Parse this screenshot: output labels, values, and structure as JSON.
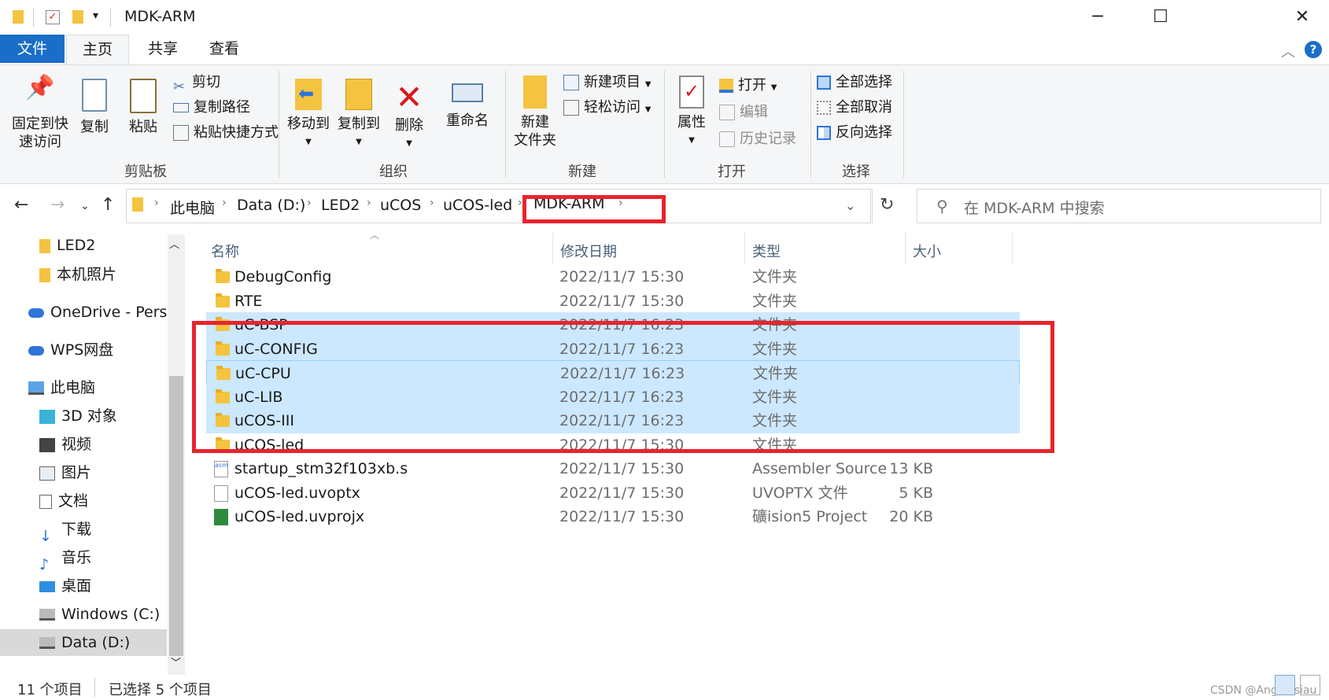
{
  "window": {
    "title": "MDK-ARM",
    "minimize": "─",
    "maximize": "☐",
    "close": "✕",
    "help": "?",
    "collapse": "︿"
  },
  "tabs": [
    "文件",
    "主页",
    "共享",
    "查看"
  ],
  "ribbon": {
    "clipboard": {
      "pin_label1": "固定到快",
      "pin_label2": "速访问",
      "copy": "复制",
      "paste": "粘贴",
      "cut": "剪切",
      "copy_path": "复制路径",
      "paste_shortcut": "粘贴快捷方式",
      "group": "剪贴板"
    },
    "organize": {
      "move_to": "移动到",
      "copy_to": "复制到",
      "delete": "删除",
      "rename": "重命名",
      "group": "组织"
    },
    "new": {
      "new_folder1": "新建",
      "new_folder2": "文件夹",
      "new_item": "新建项目",
      "easy_access": "轻松访问",
      "group": "新建"
    },
    "open": {
      "properties": "属性",
      "open": "打开",
      "edit": "编辑",
      "history": "历史记录",
      "group": "打开"
    },
    "select": {
      "select_all": "全部选择",
      "select_none": "全部取消",
      "invert": "反向选择",
      "group": "选择"
    }
  },
  "address": {
    "crumbs": [
      "此电脑",
      "Data (D:)",
      "LED2",
      "uCOS",
      "uCOS-led",
      "MDK-ARM"
    ],
    "search_placeholder": "在 MDK-ARM 中搜索"
  },
  "nav_pane": [
    {
      "label": "LED2",
      "icon": "folder-icon"
    },
    {
      "label": "本机照片",
      "icon": "folder-icon"
    },
    {
      "label": "OneDrive - Perso",
      "icon": "cloud-icon"
    },
    {
      "label": "WPS网盘",
      "icon": "cloud-icon"
    },
    {
      "label": "此电脑",
      "icon": "computer-icon"
    },
    {
      "label": "3D 对象",
      "icon": "cube-icon"
    },
    {
      "label": "视频",
      "icon": "video-icon"
    },
    {
      "label": "图片",
      "icon": "picture-icon"
    },
    {
      "label": "文档",
      "icon": "document-icon"
    },
    {
      "label": "下载",
      "icon": "download-icon"
    },
    {
      "label": "音乐",
      "icon": "music-icon"
    },
    {
      "label": "桌面",
      "icon": "desktop-icon"
    },
    {
      "label": "Windows (C:)",
      "icon": "drive-icon"
    },
    {
      "label": "Data (D:)",
      "icon": "drive-icon"
    }
  ],
  "columns": {
    "name": "名称",
    "date": "修改日期",
    "type": "类型",
    "size": "大小"
  },
  "files": [
    {
      "name": "DebugConfig",
      "date": "2022/11/7 15:30",
      "type": "文件夹",
      "size": "",
      "kind": "folder",
      "selected": false
    },
    {
      "name": "RTE",
      "date": "2022/11/7 15:30",
      "type": "文件夹",
      "size": "",
      "kind": "folder",
      "selected": false
    },
    {
      "name": "uC-BSP",
      "date": "2022/11/7 16:23",
      "type": "文件夹",
      "size": "",
      "kind": "folder",
      "selected": true
    },
    {
      "name": "uC-CONFIG",
      "date": "2022/11/7 16:23",
      "type": "文件夹",
      "size": "",
      "kind": "folder",
      "selected": true
    },
    {
      "name": "uC-CPU",
      "date": "2022/11/7 16:23",
      "type": "文件夹",
      "size": "",
      "kind": "folder",
      "selected": true
    },
    {
      "name": "uC-LIB",
      "date": "2022/11/7 16:23",
      "type": "文件夹",
      "size": "",
      "kind": "folder",
      "selected": true
    },
    {
      "name": "uCOS-III",
      "date": "2022/11/7 16:23",
      "type": "文件夹",
      "size": "",
      "kind": "folder",
      "selected": true
    },
    {
      "name": "uCOS-led",
      "date": "2022/11/7 15:30",
      "type": "文件夹",
      "size": "",
      "kind": "folder",
      "selected": false
    },
    {
      "name": "startup_stm32f103xb.s",
      "date": "2022/11/7 15:30",
      "type": "Assembler Source",
      "size": "13 KB",
      "kind": "asm",
      "selected": false
    },
    {
      "name": "uCOS-led.uvoptx",
      "date": "2022/11/7 15:30",
      "type": "UVOPTX 文件",
      "size": "5 KB",
      "kind": "file",
      "selected": false
    },
    {
      "name": "uCOS-led.uvprojx",
      "date": "2022/11/7 15:30",
      "type": "礦ision5 Project",
      "size": "20 KB",
      "kind": "uv",
      "selected": false
    }
  ],
  "status": {
    "count": "11 个项目",
    "selected": "已选择 5 个项目"
  },
  "watermark": "CSDN @Angelasiau"
}
